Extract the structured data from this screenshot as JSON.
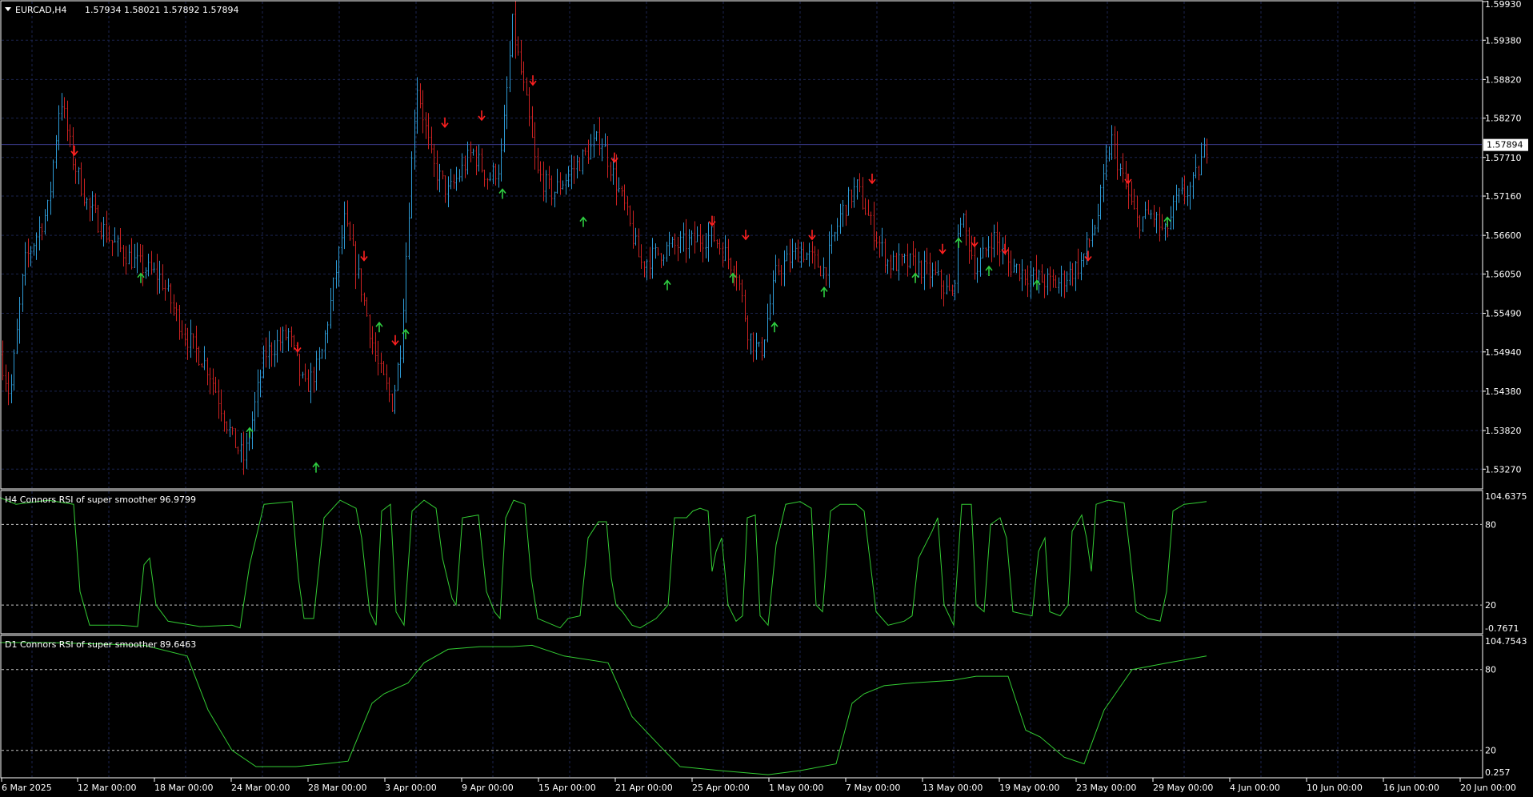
{
  "chart_header": {
    "menu_icon": "triangle-down-icon",
    "symbol": "EURCAD,H4",
    "ohlc": "1.57934 1.58021 1.57892 1.57894"
  },
  "colors": {
    "background": "#000000",
    "grid": "#1b2450",
    "frame": "#ffffff",
    "bull_candle": "#2e9bd6",
    "bear_candle": "#cc2222",
    "buy_arrow": "#2ecc40",
    "sell_arrow": "#ff2020",
    "indicator_line": "#33cc33",
    "price_tag_bg": "#ffffff",
    "price_tag_text": "#000000"
  },
  "price_axis": {
    "ticks": [
      "1.59930",
      "1.59380",
      "1.58820",
      "1.58270",
      "1.57710",
      "1.57160",
      "1.56600",
      "1.56050",
      "1.55490",
      "1.54940",
      "1.54380",
      "1.53820",
      "1.53270"
    ],
    "current_price": "1.57894"
  },
  "indicator_h4": {
    "title": "H4 Connors RSI of super smoother 96.9799",
    "axis_labels": [
      "104.6375",
      "80",
      "20",
      "-0.7671"
    ],
    "levels": [
      80,
      20
    ]
  },
  "indicator_d1": {
    "title": "D1 Connors RSI of super smoother 89.6463",
    "axis_labels": [
      "104.7543",
      "80",
      "20",
      "0.257"
    ],
    "levels": [
      80,
      20
    ]
  },
  "time_axis": {
    "labels": [
      "6 Mar 2025",
      "12 Mar 00:00",
      "18 Mar 00:00",
      "24 Mar 00:00",
      "28 Mar 00:00",
      "3 Apr 00:00",
      "9 Apr 00:00",
      "15 Apr 00:00",
      "21 Apr 00:00",
      "25 Apr 00:00",
      "1 May 00:00",
      "7 May 00:00",
      "13 May 00:00",
      "19 May 00:00",
      "23 May 00:00",
      "29 May 00:00",
      "4 Jun 00:00",
      "10 Jun 00:00",
      "16 Jun 00:00",
      "20 Jun 00:00"
    ]
  },
  "chart_data": {
    "type": "candlestick",
    "symbol": "EURCAD",
    "timeframe": "H4",
    "ylim": [
      1.53,
      1.5993
    ],
    "price_anchors": [
      [
        0,
        1.549
      ],
      [
        12,
        1.543
      ],
      [
        30,
        1.562
      ],
      [
        60,
        1.57
      ],
      [
        75,
        1.586
      ],
      [
        90,
        1.577
      ],
      [
        110,
        1.57
      ],
      [
        140,
        1.565
      ],
      [
        170,
        1.562
      ],
      [
        200,
        1.56
      ],
      [
        230,
        1.552
      ],
      [
        260,
        1.547
      ],
      [
        290,
        1.537
      ],
      [
        305,
        1.534
      ],
      [
        330,
        1.549
      ],
      [
        360,
        1.552
      ],
      [
        380,
        1.544
      ],
      [
        400,
        1.548
      ],
      [
        430,
        1.568
      ],
      [
        450,
        1.559
      ],
      [
        470,
        1.548
      ],
      [
        490,
        1.542
      ],
      [
        500,
        1.55
      ],
      [
        520,
        1.588
      ],
      [
        540,
        1.576
      ],
      [
        560,
        1.572
      ],
      [
        590,
        1.578
      ],
      [
        610,
        1.574
      ],
      [
        625,
        1.576
      ],
      [
        640,
        1.596
      ],
      [
        660,
        1.583
      ],
      [
        670,
        1.575
      ],
      [
        690,
        1.572
      ],
      [
        720,
        1.576
      ],
      [
        750,
        1.58
      ],
      [
        780,
        1.57
      ],
      [
        800,
        1.562
      ],
      [
        830,
        1.564
      ],
      [
        860,
        1.565
      ],
      [
        890,
        1.566
      ],
      [
        920,
        1.561
      ],
      [
        935,
        1.552
      ],
      [
        950,
        1.549
      ],
      [
        970,
        1.561
      ],
      [
        1000,
        1.564
      ],
      [
        1030,
        1.561
      ],
      [
        1050,
        1.569
      ],
      [
        1070,
        1.573
      ],
      [
        1090,
        1.567
      ],
      [
        1110,
        1.562
      ],
      [
        1140,
        1.562
      ],
      [
        1170,
        1.56
      ],
      [
        1190,
        1.557
      ],
      [
        1200,
        1.569
      ],
      [
        1220,
        1.561
      ],
      [
        1240,
        1.566
      ],
      [
        1260,
        1.562
      ],
      [
        1290,
        1.56
      ],
      [
        1320,
        1.559
      ],
      [
        1350,
        1.562
      ],
      [
        1370,
        1.568
      ],
      [
        1388,
        1.58
      ],
      [
        1400,
        1.575
      ],
      [
        1420,
        1.568
      ],
      [
        1440,
        1.569
      ],
      [
        1455,
        1.566
      ],
      [
        1470,
        1.571
      ],
      [
        1490,
        1.573
      ],
      [
        1508,
        1.5789
      ]
    ],
    "sell_arrows": [
      [
        93,
        1.578
      ],
      [
        372,
        1.55
      ],
      [
        455,
        1.563
      ],
      [
        494,
        1.551
      ],
      [
        556,
        1.582
      ],
      [
        602,
        1.583
      ],
      [
        666,
        1.588
      ],
      [
        768,
        1.577
      ],
      [
        890,
        1.568
      ],
      [
        932,
        1.566
      ],
      [
        1015,
        1.566
      ],
      [
        1090,
        1.574
      ],
      [
        1178,
        1.564
      ],
      [
        1218,
        1.565
      ],
      [
        1256,
        1.564
      ],
      [
        1360,
        1.563
      ],
      [
        1410,
        1.574
      ]
    ],
    "buy_arrows": [
      [
        176,
        1.56
      ],
      [
        312,
        1.538
      ],
      [
        395,
        1.533
      ],
      [
        474,
        1.553
      ],
      [
        507,
        1.552
      ],
      [
        628,
        1.572
      ],
      [
        729,
        1.568
      ],
      [
        834,
        1.559
      ],
      [
        916,
        1.56
      ],
      [
        968,
        1.553
      ],
      [
        1030,
        1.558
      ],
      [
        1144,
        1.56
      ],
      [
        1198,
        1.565
      ],
      [
        1236,
        1.561
      ],
      [
        1296,
        1.559
      ],
      [
        1459,
        1.568
      ]
    ],
    "h4_indicator": {
      "ylim": [
        -0.7671,
        104.6375
      ],
      "points": [
        [
          0,
          100
        ],
        [
          20,
          95
        ],
        [
          60,
          98
        ],
        [
          92,
          95
        ],
        [
          100,
          30
        ],
        [
          112,
          5
        ],
        [
          150,
          5
        ],
        [
          172,
          4
        ],
        [
          180,
          50
        ],
        [
          187,
          55
        ],
        [
          195,
          20
        ],
        [
          210,
          8
        ],
        [
          250,
          4
        ],
        [
          290,
          5
        ],
        [
          300,
          3
        ],
        [
          312,
          50
        ],
        [
          330,
          95
        ],
        [
          365,
          97
        ],
        [
          373,
          40
        ],
        [
          380,
          10
        ],
        [
          392,
          10
        ],
        [
          405,
          85
        ],
        [
          425,
          98
        ],
        [
          445,
          92
        ],
        [
          452,
          70
        ],
        [
          462,
          15
        ],
        [
          470,
          5
        ],
        [
          477,
          90
        ],
        [
          488,
          95
        ],
        [
          495,
          15
        ],
        [
          505,
          5
        ],
        [
          515,
          90
        ],
        [
          530,
          98
        ],
        [
          545,
          92
        ],
        [
          553,
          55
        ],
        [
          565,
          25
        ],
        [
          570,
          20
        ],
        [
          578,
          85
        ],
        [
          598,
          87
        ],
        [
          608,
          30
        ],
        [
          618,
          15
        ],
        [
          625,
          10
        ],
        [
          632,
          85
        ],
        [
          642,
          98
        ],
        [
          656,
          95
        ],
        [
          664,
          40
        ],
        [
          672,
          10
        ],
        [
          700,
          3
        ],
        [
          710,
          10
        ],
        [
          725,
          12
        ],
        [
          735,
          70
        ],
        [
          748,
          82
        ],
        [
          758,
          82
        ],
        [
          764,
          40
        ],
        [
          770,
          20
        ],
        [
          778,
          15
        ],
        [
          790,
          5
        ],
        [
          800,
          3
        ],
        [
          820,
          10
        ],
        [
          835,
          20
        ],
        [
          843,
          85
        ],
        [
          858,
          85
        ],
        [
          866,
          90
        ],
        [
          875,
          92
        ],
        [
          885,
          90
        ],
        [
          890,
          45
        ],
        [
          895,
          60
        ],
        [
          902,
          70
        ],
        [
          910,
          20
        ],
        [
          920,
          8
        ],
        [
          928,
          12
        ],
        [
          934,
          85
        ],
        [
          944,
          87
        ],
        [
          950,
          12
        ],
        [
          960,
          5
        ],
        [
          970,
          65
        ],
        [
          982,
          95
        ],
        [
          1000,
          97
        ],
        [
          1014,
          92
        ],
        [
          1020,
          20
        ],
        [
          1028,
          15
        ],
        [
          1038,
          90
        ],
        [
          1050,
          95
        ],
        [
          1070,
          95
        ],
        [
          1080,
          90
        ],
        [
          1095,
          15
        ],
        [
          1110,
          5
        ],
        [
          1130,
          8
        ],
        [
          1140,
          12
        ],
        [
          1148,
          55
        ],
        [
          1165,
          75
        ],
        [
          1172,
          85
        ],
        [
          1180,
          20
        ],
        [
          1192,
          5
        ],
        [
          1202,
          95
        ],
        [
          1214,
          95
        ],
        [
          1220,
          20
        ],
        [
          1230,
          15
        ],
        [
          1238,
          80
        ],
        [
          1250,
          85
        ],
        [
          1258,
          70
        ],
        [
          1266,
          15
        ],
        [
          1290,
          12
        ],
        [
          1298,
          60
        ],
        [
          1306,
          70
        ],
        [
          1312,
          15
        ],
        [
          1325,
          12
        ],
        [
          1335,
          20
        ],
        [
          1340,
          75
        ],
        [
          1352,
          87
        ],
        [
          1358,
          70
        ],
        [
          1364,
          45
        ],
        [
          1370,
          95
        ],
        [
          1385,
          98
        ],
        [
          1405,
          96
        ],
        [
          1412,
          60
        ],
        [
          1420,
          15
        ],
        [
          1435,
          10
        ],
        [
          1450,
          8
        ],
        [
          1458,
          30
        ],
        [
          1466,
          90
        ],
        [
          1480,
          95
        ],
        [
          1495,
          96
        ],
        [
          1508,
          97
        ]
      ]
    },
    "d1_indicator": {
      "ylim": [
        0.257,
        104.7543
      ],
      "points": [
        [
          0,
          100
        ],
        [
          60,
          100
        ],
        [
          180,
          98
        ],
        [
          234,
          90
        ],
        [
          260,
          50
        ],
        [
          290,
          20
        ],
        [
          320,
          8
        ],
        [
          370,
          8
        ],
        [
          405,
          10
        ],
        [
          435,
          12
        ],
        [
          465,
          55
        ],
        [
          480,
          62
        ],
        [
          510,
          70
        ],
        [
          530,
          85
        ],
        [
          560,
          95
        ],
        [
          600,
          97
        ],
        [
          640,
          97
        ],
        [
          665,
          98
        ],
        [
          705,
          90
        ],
        [
          760,
          85
        ],
        [
          790,
          45
        ],
        [
          830,
          20
        ],
        [
          850,
          8
        ],
        [
          900,
          5
        ],
        [
          960,
          2
        ],
        [
          1000,
          5
        ],
        [
          1045,
          10
        ],
        [
          1065,
          55
        ],
        [
          1080,
          62
        ],
        [
          1105,
          68
        ],
        [
          1140,
          70
        ],
        [
          1190,
          72
        ],
        [
          1220,
          75
        ],
        [
          1260,
          75
        ],
        [
          1282,
          35
        ],
        [
          1300,
          30
        ],
        [
          1330,
          15
        ],
        [
          1355,
          10
        ],
        [
          1380,
          50
        ],
        [
          1415,
          80
        ],
        [
          1460,
          85
        ],
        [
          1508,
          90
        ]
      ]
    }
  }
}
